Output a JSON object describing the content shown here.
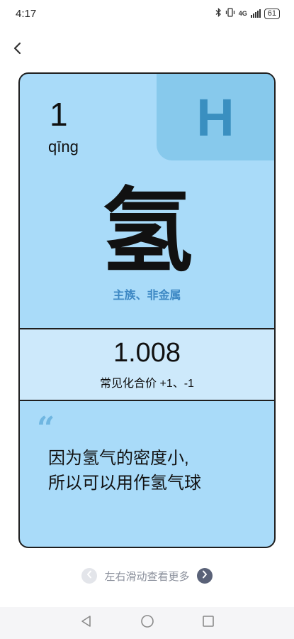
{
  "status_bar": {
    "time": "4:17",
    "network": "4G",
    "battery": "61"
  },
  "element": {
    "atomic_number": "1",
    "pinyin": "qīng",
    "symbol": "H",
    "hanzi": "氢",
    "category": "主族、非金属",
    "atomic_mass": "1.008",
    "valence": "常见化合价 +1、-1",
    "quote_mark": "“",
    "fact_lines": [
      "因为氢气的密度小,",
      "所以可以用作氢气球"
    ]
  },
  "swipe_hint": "左右滑动查看更多",
  "colors": {
    "card_bg": "#a9dbf9",
    "symbol_bg": "#87c9ec",
    "symbol_text": "#3a8fc0",
    "category_text": "#3d88c4",
    "mass_band_bg": "#cde9fb"
  },
  "icons": [
    "back-chevron-icon",
    "bluetooth-icon",
    "vibrate-icon",
    "signal-icon",
    "battery-icon",
    "prev-arrow-icon",
    "next-arrow-icon",
    "nav-back-icon",
    "nav-home-icon",
    "nav-recents-icon"
  ]
}
